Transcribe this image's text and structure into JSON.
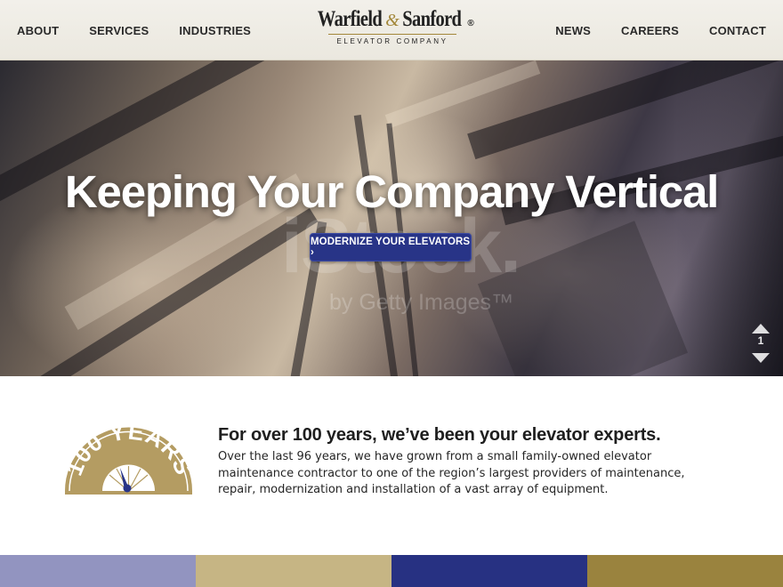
{
  "header": {
    "nav_left": [
      "ABOUT",
      "SERVICES",
      "INDUSTRIES"
    ],
    "nav_right": [
      "NEWS",
      "CAREERS",
      "CONTACT"
    ],
    "logo": {
      "name_left": "Warfield",
      "ampersand": "&",
      "name_right": "Sanford",
      "registered": "®",
      "subtitle": "ELEVATOR COMPANY"
    }
  },
  "hero": {
    "title": "Keeping Your Company Vertical",
    "cta_label": "MODERNIZE YOUR ELEVATORS ›",
    "watermark_main": "iStock.",
    "watermark_sub": "by Getty Images™",
    "slide_number": "1"
  },
  "intro": {
    "badge_text": "100 YEARS",
    "heading": "For over 100 years, we’ve been your elevator experts.",
    "body": "Over the last 96 years, we have grown from a small family-owned elevator maintenance contractor to one of the region’s largest providers of maintenance, repair, modernization and installation of a vast array of equipment."
  },
  "colors": {
    "brand_navy": "#283487",
    "brand_gold": "#a3873a",
    "badge_gold": "#b49c62",
    "bands": [
      "#9294c0",
      "#c6b584",
      "#273182",
      "#9a833e"
    ]
  }
}
